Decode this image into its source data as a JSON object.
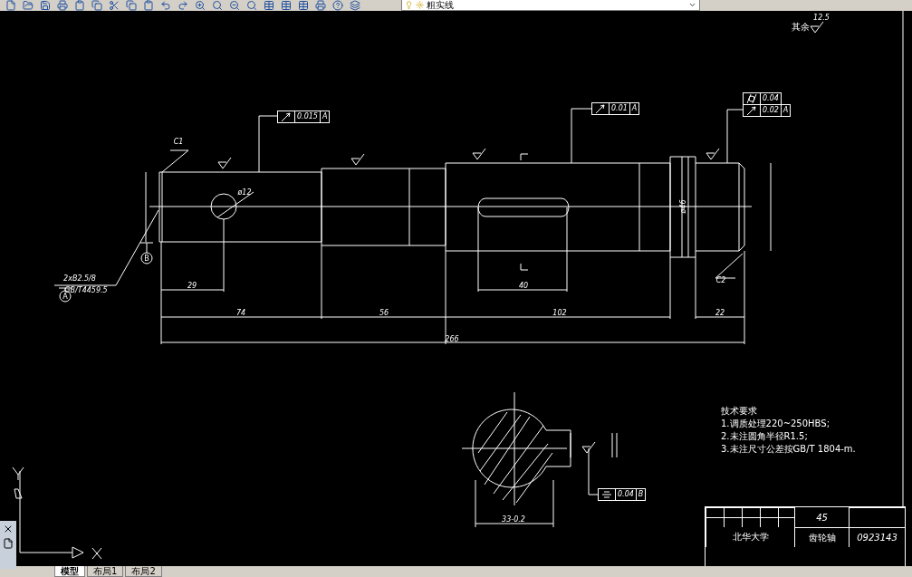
{
  "toolbar": {
    "layer": "粗实线"
  },
  "labels": [
    {
      "text": "12.5",
      "kind": "h"
    },
    {
      "text": "其余",
      "kind": "note"
    },
    {
      "text": "C1",
      "kind": "h"
    },
    {
      "text": "ø12",
      "kind": "h"
    },
    {
      "text": "ø46",
      "kind": "v"
    },
    {
      "text": "2xB2.5/8",
      "kind": "h"
    },
    {
      "text": "C2",
      "kind": "h"
    },
    {
      "text": "29",
      "kind": "h"
    },
    {
      "text": "40",
      "kind": "h"
    },
    {
      "text": "GB/T4459.5",
      "kind": "h"
    },
    {
      "text": "74",
      "kind": "h"
    },
    {
      "text": "56",
      "kind": "h"
    },
    {
      "text": "102",
      "kind": "h"
    },
    {
      "text": "22",
      "kind": "h"
    },
    {
      "text": "266",
      "kind": "h"
    },
    {
      "text": "33-0.2",
      "kind": "h"
    }
  ],
  "datums": [
    "A",
    "B"
  ],
  "tolerance_frames": [
    {
      "kind": "runout",
      "value": "0.015",
      "datum": "A"
    },
    {
      "kind": "runout",
      "value": "0.01",
      "datum": "A"
    },
    {
      "kind": "cylindricity",
      "value": "0.04"
    },
    {
      "kind": "runout",
      "value": "0.02",
      "datum": "A"
    },
    {
      "kind": "symmetry",
      "value": "0.04",
      "datum": "B"
    }
  ],
  "notes": [
    "技术要求",
    "1.调质处理220~250HBS;",
    "2.未注圆角半径R1.5;",
    "3.未注尺寸公差按GB/T 1804-m."
  ],
  "title_block": {
    "material": "45",
    "school": "北华大学",
    "part": "齿轮轴",
    "number": "0923143"
  },
  "layout_tabs": [
    {
      "label": "模型",
      "selected": true
    },
    {
      "label": "布局1",
      "selected": false
    },
    {
      "label": "布局2",
      "selected": false
    }
  ]
}
